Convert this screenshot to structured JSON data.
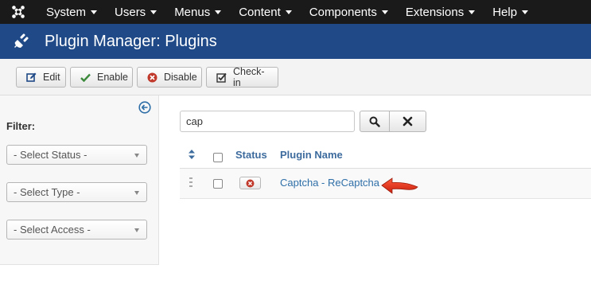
{
  "topnav": {
    "items": [
      {
        "label": "System"
      },
      {
        "label": "Users"
      },
      {
        "label": "Menus"
      },
      {
        "label": "Content"
      },
      {
        "label": "Components"
      },
      {
        "label": "Extensions"
      },
      {
        "label": "Help"
      }
    ]
  },
  "title": "Plugin Manager: Plugins",
  "toolbar": {
    "edit": "Edit",
    "enable": "Enable",
    "disable": "Disable",
    "checkin": "Check-in"
  },
  "sidebar": {
    "filter_label": "Filter:",
    "status_select": "- Select Status -",
    "type_select": "- Select Type -",
    "access_select": "- Select Access -"
  },
  "search": {
    "value": "cap"
  },
  "table": {
    "columns": {
      "status": "Status",
      "plugin_name": "Plugin Name"
    },
    "rows": [
      {
        "name": "Captcha - ReCaptcha",
        "status": "disabled"
      }
    ]
  },
  "colors": {
    "topnav_bg": "#1a1a1a",
    "title_bg": "#1f4a87",
    "link": "#2f6fa8",
    "disabled_red": "#c0392b",
    "enable_green": "#3c8a3c",
    "annotation_arrow": "#e0321e"
  }
}
